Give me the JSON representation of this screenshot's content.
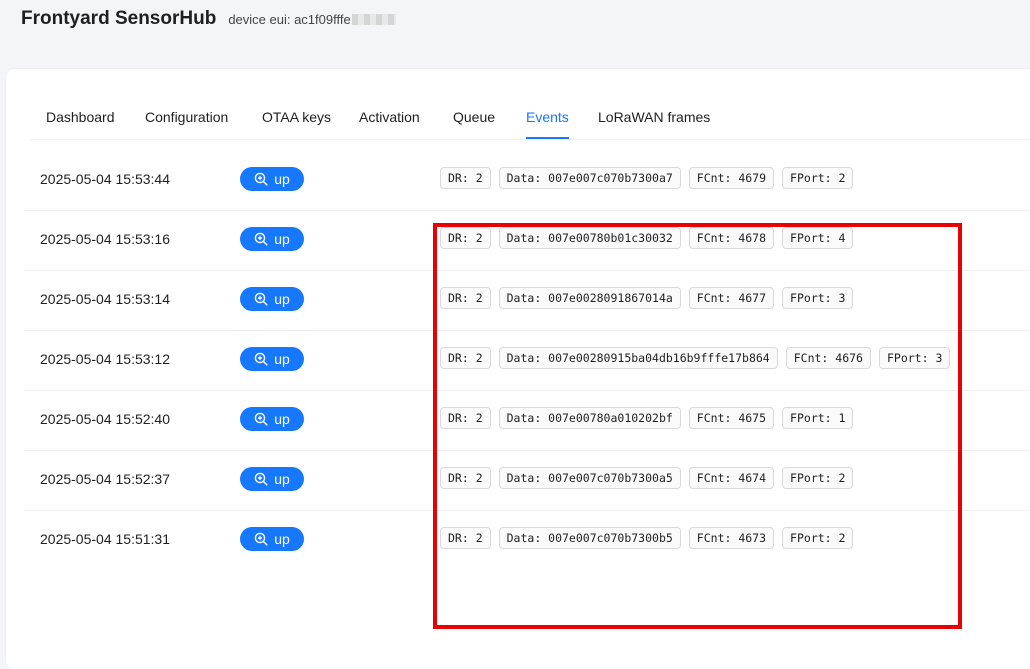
{
  "app": {
    "title": "Frontyard SensorHub",
    "device_eui_label": "device eui: ac1f09fffe"
  },
  "tabs": [
    {
      "label": "Dashboard"
    },
    {
      "label": "Configuration"
    },
    {
      "label": "OTAA keys"
    },
    {
      "label": "Activation"
    },
    {
      "label": "Queue"
    },
    {
      "label": "Events"
    },
    {
      "label": "LoRaWAN frames"
    }
  ],
  "active_tab": "Events",
  "accent_color": "#1677ff",
  "highlight_color": "#ea0000",
  "events": [
    {
      "timestamp": "2025-05-04 15:53:44",
      "type": "up",
      "dr": "DR: 2",
      "data": "Data: 007e007c070b7300a7",
      "fcnt": "FCnt: 4679",
      "fport": "FPort: 2"
    },
    {
      "timestamp": "2025-05-04 15:53:16",
      "type": "up",
      "dr": "DR: 2",
      "data": "Data: 007e00780b01c30032",
      "fcnt": "FCnt: 4678",
      "fport": "FPort: 4"
    },
    {
      "timestamp": "2025-05-04 15:53:14",
      "type": "up",
      "dr": "DR: 2",
      "data": "Data: 007e0028091867014a",
      "fcnt": "FCnt: 4677",
      "fport": "FPort: 3"
    },
    {
      "timestamp": "2025-05-04 15:53:12",
      "type": "up",
      "dr": "DR: 2",
      "data": "Data: 007e00280915ba04db16b9fffe17b864",
      "fcnt": "FCnt: 4676",
      "fport": "FPort: 3"
    },
    {
      "timestamp": "2025-05-04 15:52:40",
      "type": "up",
      "dr": "DR: 2",
      "data": "Data: 007e00780a010202bf",
      "fcnt": "FCnt: 4675",
      "fport": "FPort: 1"
    },
    {
      "timestamp": "2025-05-04 15:52:37",
      "type": "up",
      "dr": "DR: 2",
      "data": "Data: 007e007c070b7300a5",
      "fcnt": "FCnt: 4674",
      "fport": "FPort: 2"
    },
    {
      "timestamp": "2025-05-04 15:51:31",
      "type": "up",
      "dr": "DR: 2",
      "data": "Data: 007e007c070b7300b5",
      "fcnt": "FCnt: 4673",
      "fport": "FPort: 2"
    }
  ]
}
